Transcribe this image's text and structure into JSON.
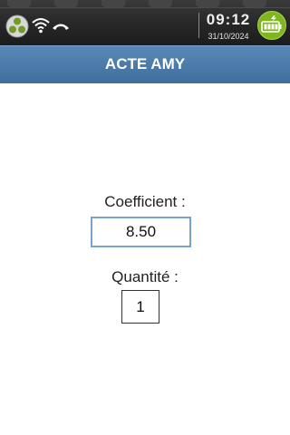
{
  "status_bar": {
    "time": "09:12",
    "date": "31/10/2024",
    "icons": [
      "network-icon",
      "wifi-icon",
      "phone-hangup-icon",
      "battery-charging-icon"
    ],
    "colors": {
      "background": "#2b2b2b",
      "battery_badge": "#7fb51f"
    }
  },
  "header": {
    "title": "ACTE AMY",
    "background": "#4a7aa9"
  },
  "form": {
    "coefficient_label": "Coefficient :",
    "coefficient_value": "8.50",
    "quantity_label": "Quantité :",
    "quantity_value": "1",
    "focus_color": "#7aa3c9"
  }
}
